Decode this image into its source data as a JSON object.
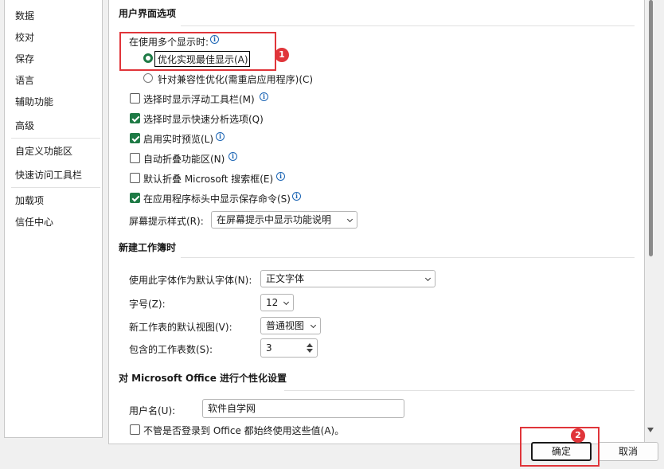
{
  "nav": {
    "items": [
      "数据",
      "校对",
      "保存",
      "语言",
      "辅助功能",
      "高级",
      "自定义功能区",
      "快速访问工具栏",
      "加载项",
      "信任中心"
    ]
  },
  "ui_options": {
    "title": "用户界面选项",
    "multi_display_label": "在使用多个显示时:",
    "radio_optimize": "优化实现最佳显示(A)",
    "radio_compat": "针对兼容性优化(需重启应用程序)(C)",
    "chk_minitoolbar": "选择时显示浮动工具栏(M)",
    "chk_quickanalysis": "选择时显示快速分析选项(Q)",
    "chk_livepreview": "启用实时预览(L)",
    "chk_collapse_ribbon": "自动折叠功能区(N)",
    "chk_collapse_search": "默认折叠 Microsoft 搜索框(E)",
    "chk_show_save": "在应用程序标头中显示保存命令(S)",
    "screentip_label": "屏幕提示样式(R):",
    "screentip_value": "在屏幕提示中显示功能说明"
  },
  "new_workbook": {
    "title": "新建工作簿时",
    "font_label": "使用此字体作为默认字体(N):",
    "font_value": "正文字体",
    "size_label": "字号(Z):",
    "size_value": "12",
    "view_label": "新工作表的默认视图(V):",
    "view_value": "普通视图",
    "sheets_label": "包含的工作表数(S):",
    "sheets_value": "3"
  },
  "personalize": {
    "title": "对 Microsoft Office 进行个性化设置",
    "username_label": "用户名(U):",
    "username_value": "软件自学网",
    "always_use_label": "不管是否登录到 Office 都始终使用这些值(A)。"
  },
  "buttons": {
    "ok": "确定",
    "cancel": "取消"
  },
  "annotations": {
    "badge1": "1",
    "badge2": "2"
  },
  "icons": {
    "info": "i"
  },
  "colors": {
    "accent_green": "#1e7a45",
    "annotation_red": "#e0353a",
    "info_blue": "#1a64b4"
  }
}
